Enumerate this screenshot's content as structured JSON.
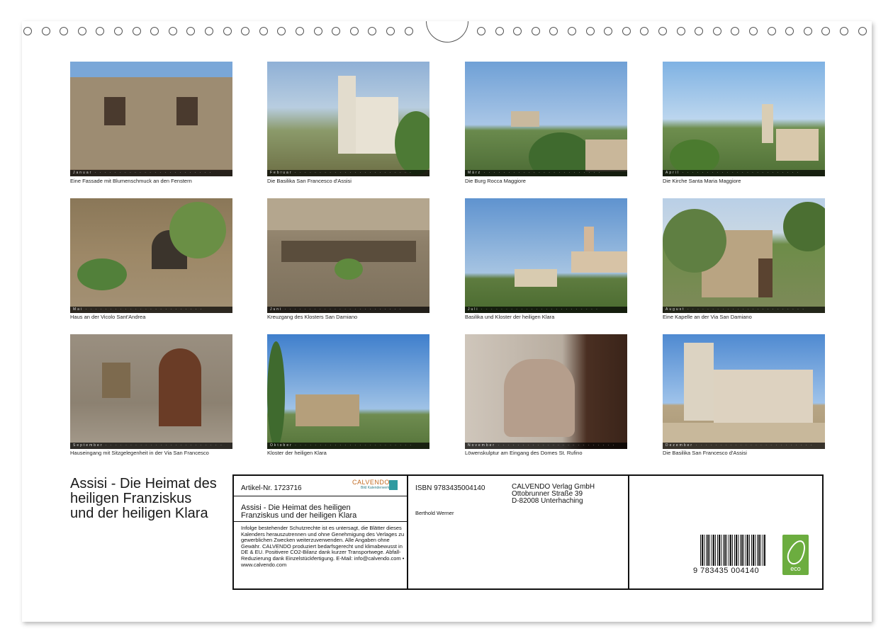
{
  "calendar": {
    "photos": [
      {
        "month_tag": "Januar",
        "caption": "Eine Fassade mit Blumenschmuck an den Fenstern"
      },
      {
        "month_tag": "Februar",
        "caption": "Die Basilika San Francesco d'Assisi"
      },
      {
        "month_tag": "März",
        "caption": "Die Burg Rocca Maggiore"
      },
      {
        "month_tag": "April",
        "caption": "Die Kirche Santa Maria Maggiore"
      },
      {
        "month_tag": "Mai",
        "caption": "Haus an der Vicolo Sant'Andrea"
      },
      {
        "month_tag": "Juni",
        "caption": "Kreuzgang des Klosters San Damiano"
      },
      {
        "month_tag": "Juli",
        "caption": "Basilika und Kloster der heiligen Klara"
      },
      {
        "month_tag": "August",
        "caption": "Eine Kapelle an der Via San Damiano"
      },
      {
        "month_tag": "September",
        "caption": "Hauseingang mit Sitzgelegenheit in der Via San Francesco"
      },
      {
        "month_tag": "Oktober",
        "caption": "Kloster der heiligen Klara"
      },
      {
        "month_tag": "November",
        "caption": "Löwenskulptur am Eingang des Domes St. Rufino"
      },
      {
        "month_tag": "Dezember",
        "caption": "Die Basilika San Francesco d'Assisi"
      }
    ],
    "title": "Assisi - Die Heimat des heiligen Franziskus und der heiligen Klara"
  },
  "info": {
    "article_no": "Artikel-Nr. 1723716",
    "brand": "CALVENDO",
    "brand_sub": "Bild Kalenderwerk",
    "product_title": "Assisi - Die Heimat des heiligen Franziskus und der heiligen Klara",
    "legal": "Infolge bestehender Schutzrechte ist es untersagt, die Blätter dieses Kalenders herauszutrennen und ohne Genehmigung des Verlages zu gewerblichen Zwecken weiterzuverwenden. Alle Angaben ohne Gewähr. CALVENDO produziert bedarfsgerecht und klimabewusst in DE & EU. Positivere CO2-Bilanz dank kurzer Transportwege. Abfall-Reduzierung dank Einzelstückfertigung. E-Mail: info@calvendo.com • www.calvendo.com",
    "isbn": "ISBN 9783435004140",
    "author": "Berthold Werner",
    "publisher_name": "CALVENDO Verlag GmbH",
    "publisher_street": "Ottobrunner Straße 39",
    "publisher_city": "D-82008 Unterhaching",
    "barcode_digits": "9 783435 004140",
    "eco_label": "eco"
  }
}
